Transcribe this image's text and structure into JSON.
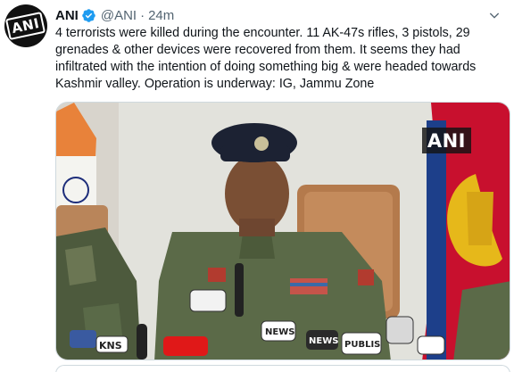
{
  "tweet": {
    "author_name": "ANI",
    "handle": "@ANI",
    "separator": "·",
    "time": "24m",
    "text": "4 terrorists were killed during the encounter. 11 AK-47s rifles, 3 pistols, 29 grenades & other devices were recovered from them. It seems they had infiltrated with the intention of doing something big & were headed towards Kashmir valley. Operation is underway: IG, Jammu Zone",
    "avatar_logo": "ANI",
    "media": {
      "watermark": "ANI",
      "mic_labels": [
        "KNS",
        "NEWS",
        "NEWS",
        "PUBLIS"
      ]
    }
  },
  "colors": {
    "verified": "#1d9bf0",
    "text": "#0f1419",
    "secondary": "#536471",
    "border": "#cfd9de"
  },
  "icons": [
    "verified-badge-icon",
    "chevron-down-icon"
  ]
}
